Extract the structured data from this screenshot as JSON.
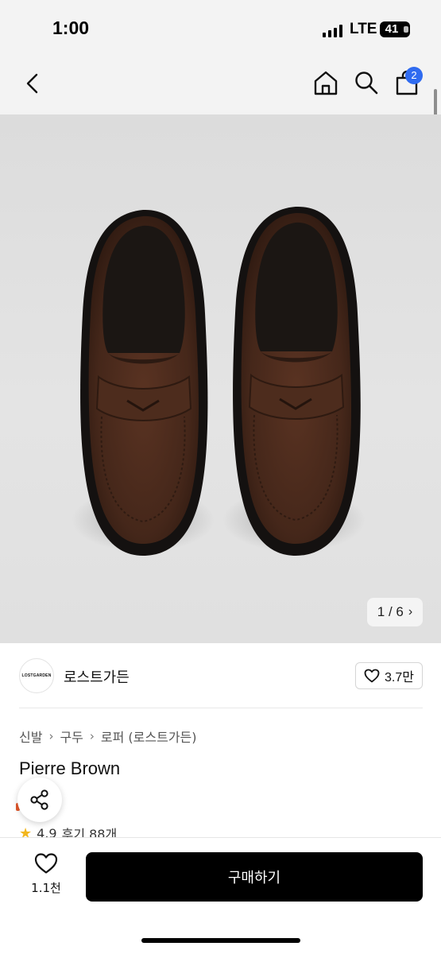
{
  "status_bar": {
    "time": "1:00",
    "network": "LTE",
    "battery": "41"
  },
  "nav": {
    "cart_count": "2",
    "icons": [
      "back-chevron",
      "home",
      "search",
      "shopping-bag"
    ]
  },
  "gallery": {
    "pager": "1 / 6"
  },
  "store": {
    "logo_text": "LOSTGARDEN",
    "name": "로스트가든",
    "likes": "3.7만"
  },
  "breadcrumb": [
    "신발",
    "구두",
    "로퍼 (로스트가든)"
  ],
  "product": {
    "title": "Pierre Brown",
    "rating": "4.9",
    "reviews": "후기 88개"
  },
  "bottom_bar": {
    "wish_count": "1.1천",
    "buy_label": "구매하기"
  },
  "colors": {
    "accent": "#2f6bf0",
    "buy_button": "#000000",
    "star": "#f2b61d"
  }
}
